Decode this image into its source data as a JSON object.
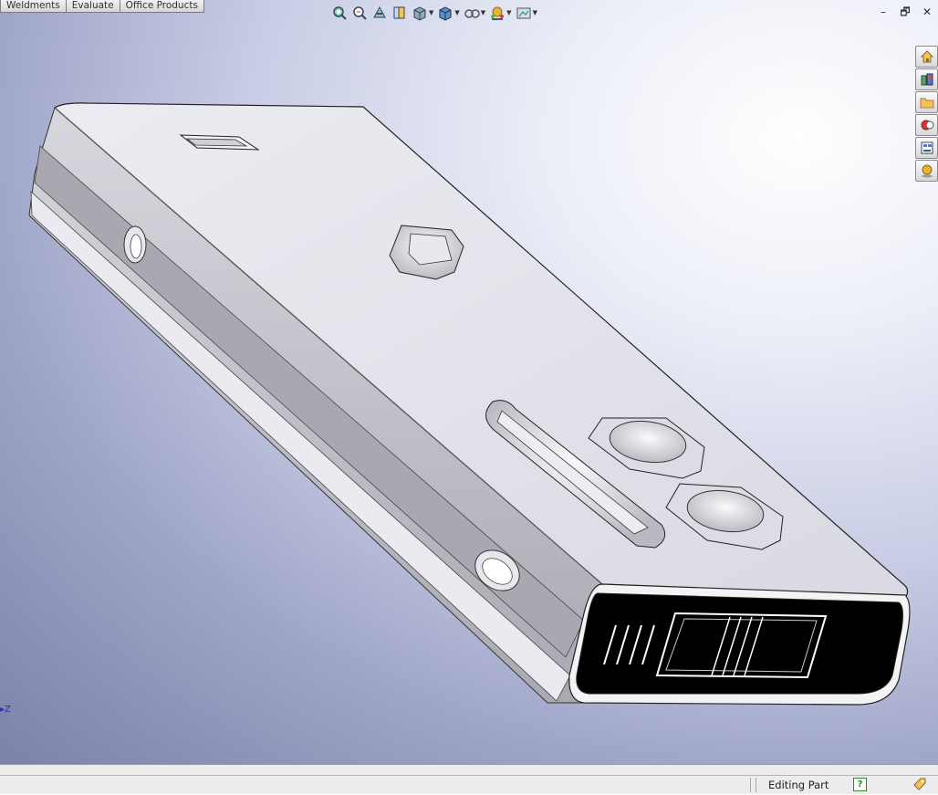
{
  "command_manager": {
    "tabs": [
      {
        "label": "Weldments"
      },
      {
        "label": "Evaluate"
      },
      {
        "label": "Office Products"
      }
    ]
  },
  "heads_up_toolbar": {
    "buttons": [
      {
        "icon": "zoom-to-fit-icon"
      },
      {
        "icon": "zoom-to-area-icon"
      },
      {
        "icon": "previous-view-icon"
      },
      {
        "icon": "section-view-icon"
      },
      {
        "icon": "view-orientation-icon",
        "dropdown": true
      },
      {
        "icon": "display-style-icon",
        "dropdown": true
      },
      {
        "icon": "hide-show-items-icon",
        "dropdown": true
      },
      {
        "icon": "edit-appearance-icon",
        "dropdown": true
      },
      {
        "icon": "apply-scene-icon",
        "dropdown": true
      }
    ]
  },
  "window_controls": {
    "minimize": "–",
    "restore": "🗗",
    "close": "✕"
  },
  "task_pane": {
    "buttons": [
      {
        "icon": "solidworks-resources-icon"
      },
      {
        "icon": "design-library-icon"
      },
      {
        "icon": "file-explorer-icon"
      },
      {
        "icon": "search-icon"
      },
      {
        "icon": "view-palette-icon"
      },
      {
        "icon": "appearances-scenes-icon"
      }
    ]
  },
  "triad": {
    "label": "Z"
  },
  "status_bar": {
    "mode_text": "Editing Part",
    "help_icon": "?"
  },
  "colors": {
    "background_top": "#c9cde5",
    "background_dark": "#7c82a8",
    "model_light": "#e2e2ee",
    "model_side": "#b4b4bc"
  }
}
